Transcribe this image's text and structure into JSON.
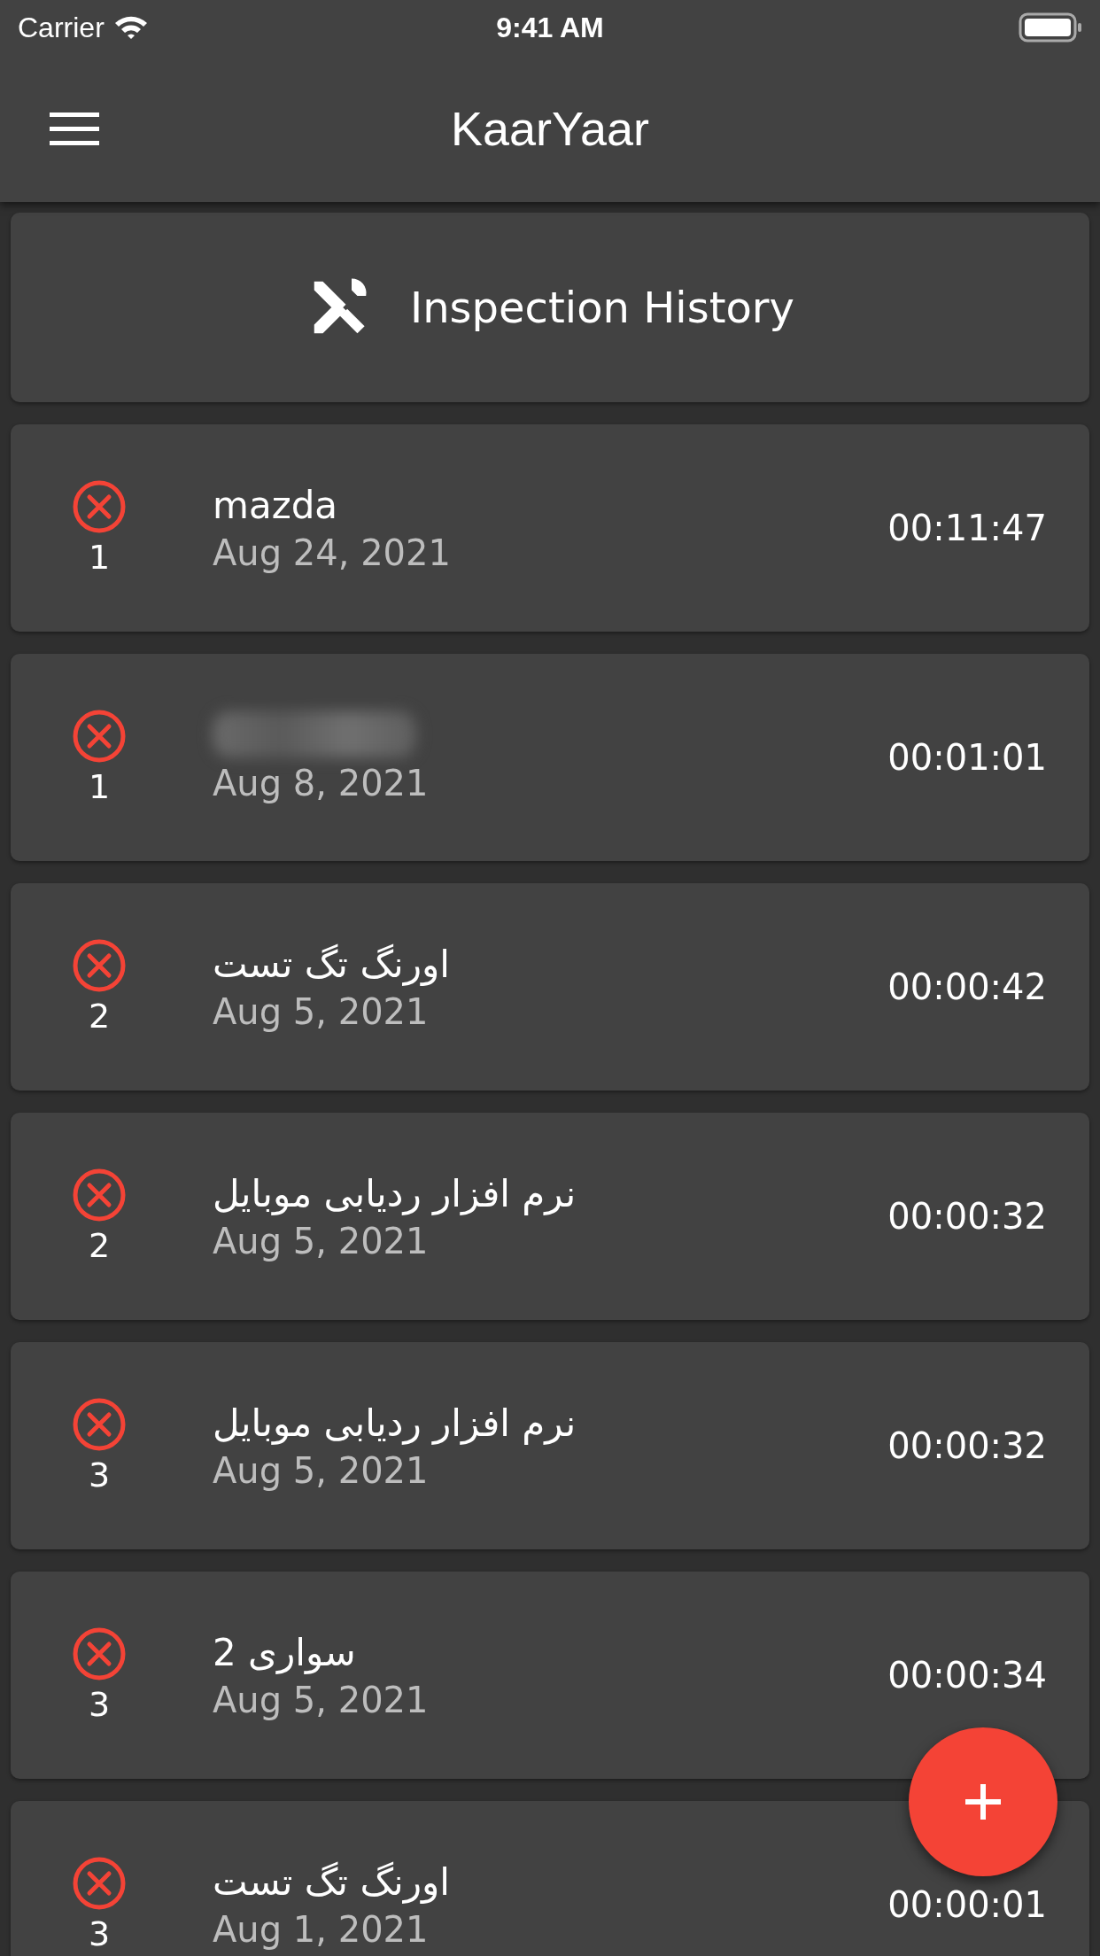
{
  "status_bar": {
    "carrier": "Carrier",
    "time": "9:41 AM"
  },
  "nav": {
    "title": "KaarYaar"
  },
  "header": {
    "title": "Inspection History"
  },
  "inspections": [
    {
      "title": "mazda",
      "blurred": false,
      "count": "1",
      "date": "Aug 24, 2021",
      "duration": "00:11:47"
    },
    {
      "blurred": true,
      "count": "1",
      "date": "Aug 8, 2021",
      "duration": "00:01:01"
    },
    {
      "title": "اورنگ تگ تست",
      "blurred": false,
      "count": "2",
      "date": "Aug 5, 2021",
      "duration": "00:00:42"
    },
    {
      "title": "نرم افزار ردیابی موبایل",
      "blurred": false,
      "count": "2",
      "date": "Aug 5, 2021",
      "duration": "00:00:32"
    },
    {
      "title": "نرم افزار ردیابی موبایل",
      "blurred": false,
      "count": "3",
      "date": "Aug 5, 2021",
      "duration": "00:00:32"
    },
    {
      "title": "سواری 2",
      "blurred": false,
      "count": "3",
      "date": "Aug 5, 2021",
      "duration": "00:00:34"
    },
    {
      "title": "اورنگ تگ تست",
      "blurred": false,
      "count": "3",
      "date": "Aug 1, 2021",
      "duration": "00:00:01"
    }
  ]
}
